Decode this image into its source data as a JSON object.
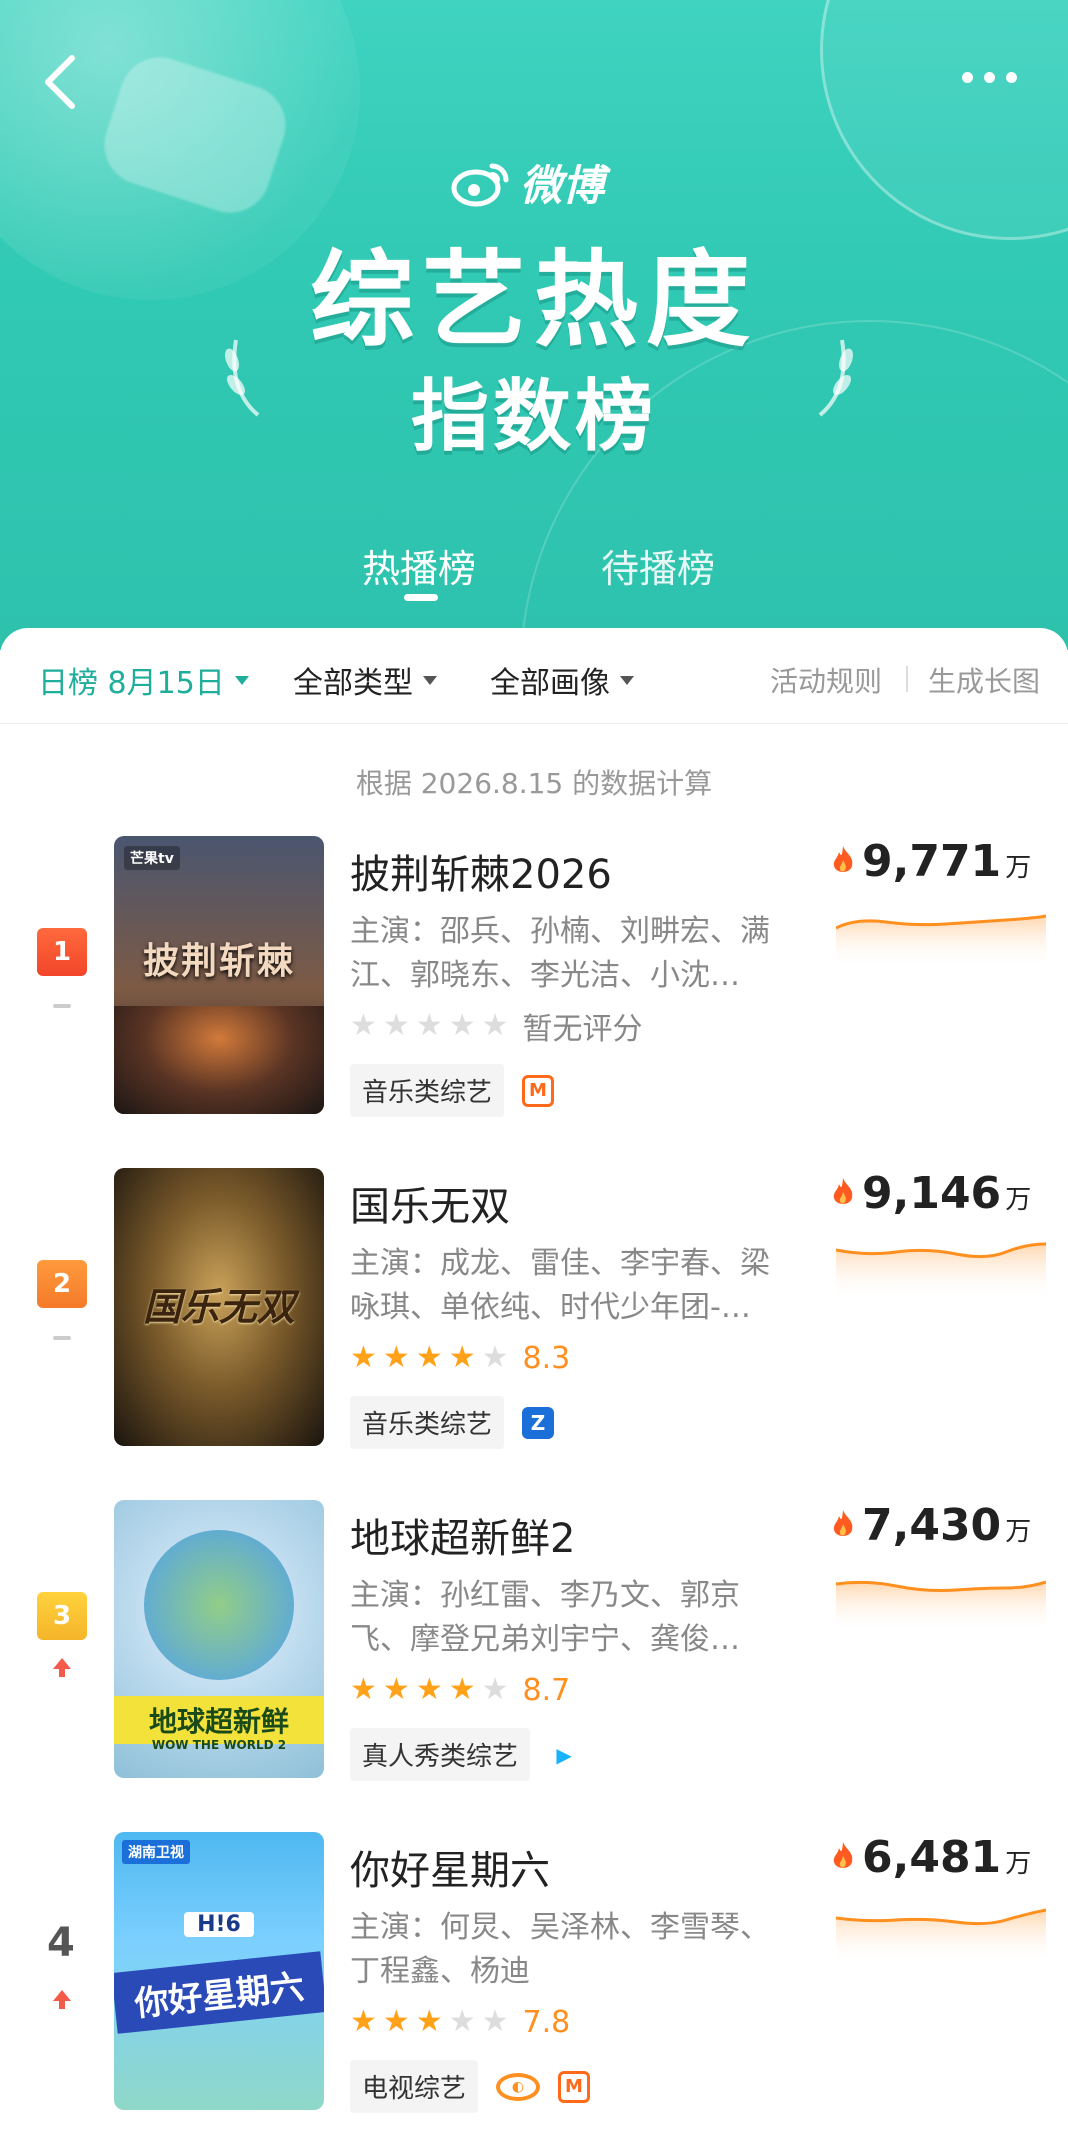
{
  "header": {
    "brand_name": "微博",
    "title_main": "综艺热度",
    "title_sub": "指数榜",
    "tabs": [
      {
        "label": "热播榜",
        "active": true
      },
      {
        "label": "待播榜",
        "active": false
      }
    ],
    "colors": {
      "primary": "#30c9b3",
      "accent": "#ff8f1f"
    }
  },
  "filters": {
    "date": "日榜 8月15日",
    "type": "全部类型",
    "image": "全部画像",
    "rules_link": "活动规则",
    "generate_link": "生成长图"
  },
  "calc_note": "根据 2026.8.15 的数据计算",
  "rankings": [
    {
      "rank": "1",
      "trend": "flat",
      "title": "披荆斩棘2026",
      "cast": "主演：邵兵、孙楠、刘畊宏、满江、郭晓东、李光洁、小沈…",
      "stars": 0,
      "score": "暂无评分",
      "tag": "音乐类综艺",
      "platforms": [
        "mango-tv-icon"
      ],
      "heat_value": "9,771",
      "heat_unit": "万",
      "poster_label": "披荆斩棘",
      "poster_brand": "芒果tv"
    },
    {
      "rank": "2",
      "trend": "flat",
      "title": "国乐无双",
      "cast": "主演：成龙、雷佳、李宇春、梁咏琪、单依纯、时代少年团-…",
      "stars": 4,
      "score": "8.3",
      "tag": "音乐类综艺",
      "platforms": [
        "zhejiang-tv-icon"
      ],
      "heat_value": "9,146",
      "heat_unit": "万",
      "poster_label": "国乐无双"
    },
    {
      "rank": "3",
      "trend": "up",
      "title": "地球超新鲜2",
      "cast": "主演：孙红雷、李乃文、郭京飞、摩登兄弟刘宇宁、龚俊…",
      "stars": 4,
      "score": "8.7",
      "tag": "真人秀类综艺",
      "platforms": [
        "tencent-video-icon"
      ],
      "heat_value": "7,430",
      "heat_unit": "万",
      "poster_label": "地球超新鲜",
      "poster_sub": "WOW THE WORLD 2"
    },
    {
      "rank": "4",
      "trend": "up",
      "title": "你好星期六",
      "cast": "主演：何炅、吴泽林、李雪琴、丁程鑫、杨迪",
      "stars": 3,
      "score": "7.8",
      "tag": "电视综艺",
      "platforms": [
        "hunan-tv-icon",
        "mango-tv-icon"
      ],
      "heat_value": "6,481",
      "heat_unit": "万",
      "poster_label": "你好星期六",
      "poster_brand": "湖南卫视",
      "poster_badge": "H!6"
    }
  ]
}
